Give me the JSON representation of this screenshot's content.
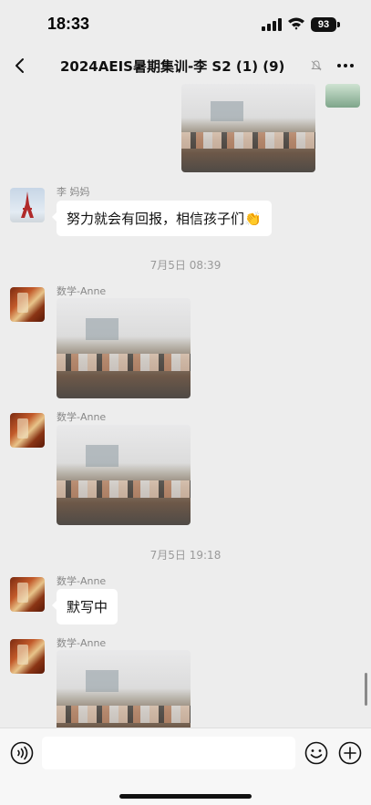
{
  "status_bar": {
    "time": "18:33",
    "battery": "93"
  },
  "nav": {
    "title": "2024AEIS暑期集训-李      S2 (1) (9)"
  },
  "messages": [
    {
      "type": "image",
      "side": "left",
      "sender": "",
      "photo": "classroom-photo"
    },
    {
      "type": "text",
      "sender": "李     妈妈",
      "text": "努力就会有回报，相信孩子们👏"
    },
    {
      "type": "time",
      "text": "7月5日 08:39"
    },
    {
      "type": "image",
      "sender": "数学-Anne",
      "photo": "classroom-photo"
    },
    {
      "type": "image",
      "sender": "数学-Anne",
      "photo": "classroom-photo"
    },
    {
      "type": "time",
      "text": "7月5日 19:18"
    },
    {
      "type": "text",
      "sender": "数学-Anne",
      "text": "默写中"
    },
    {
      "type": "image",
      "sender": "数学-Anne",
      "photo": "classroom-photo"
    }
  ],
  "input": {
    "value": "",
    "placeholder": ""
  },
  "icons": [
    "back-icon",
    "mute-icon",
    "more-icon",
    "voice-icon",
    "emoji-icon",
    "plus-icon",
    "signal-icon",
    "wifi-icon",
    "battery-icon"
  ],
  "colors": {
    "background": "#ededed",
    "bubble": "#ffffff",
    "sender_name": "#888888",
    "timestamp": "#9a9a9a"
  }
}
